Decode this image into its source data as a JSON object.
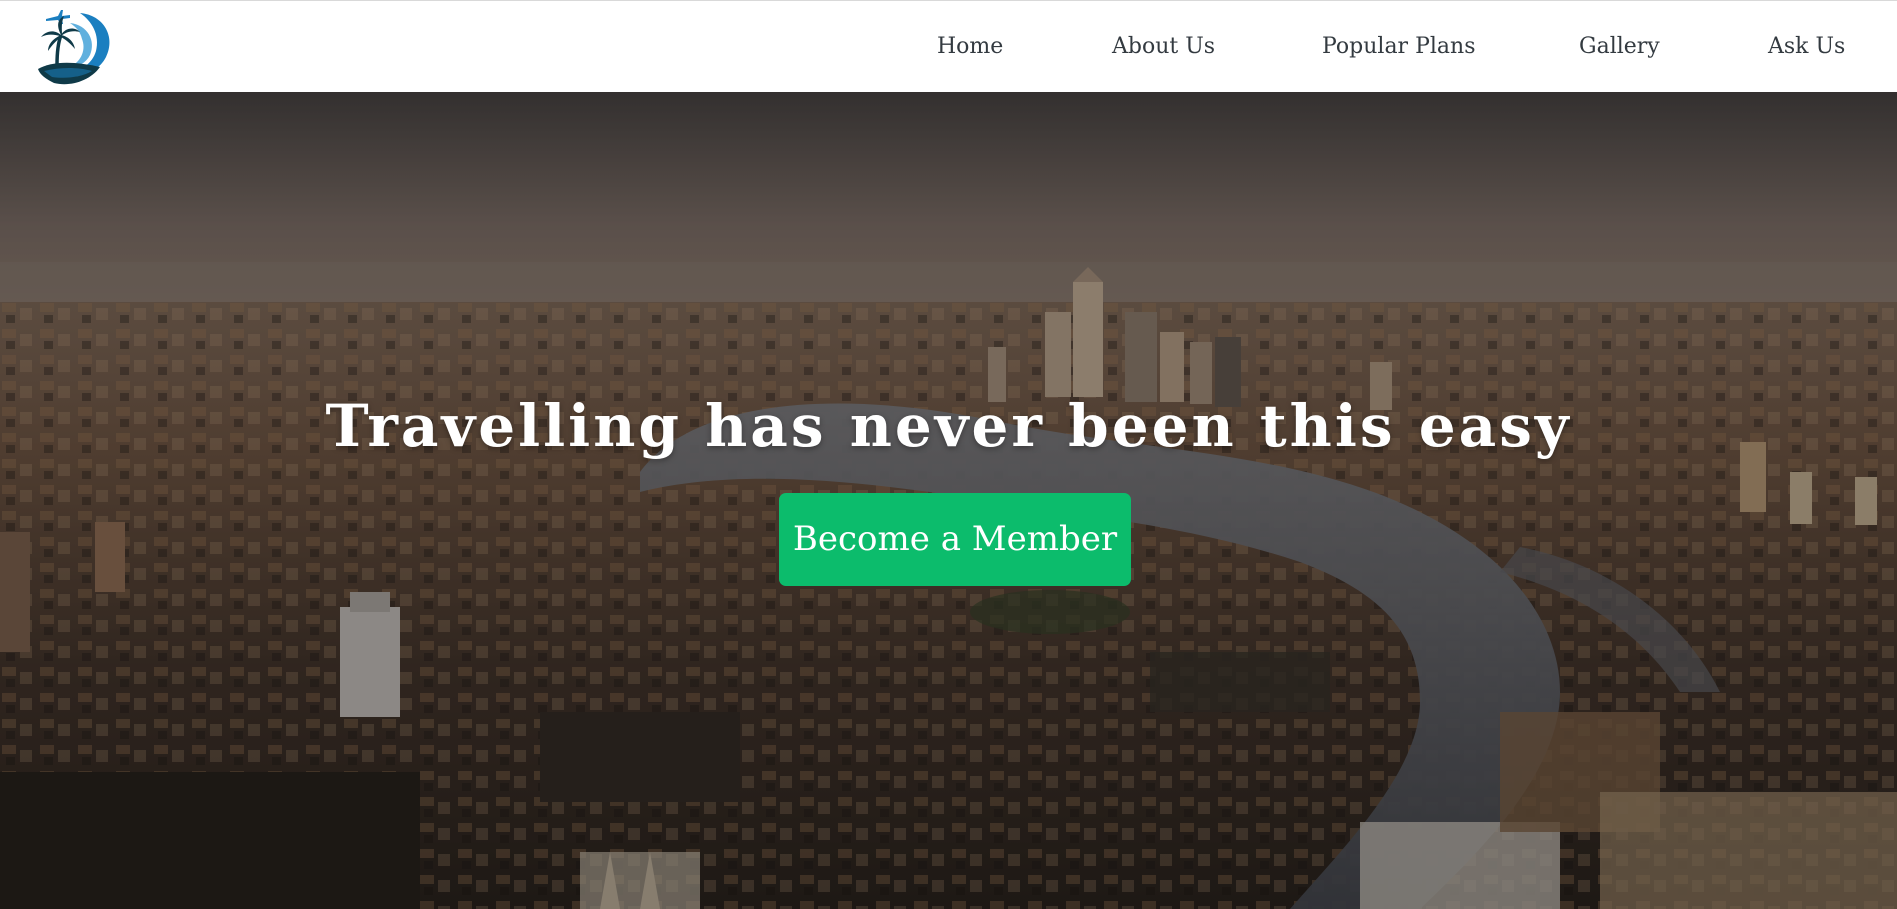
{
  "brand": {
    "logo_icon": "palm-moon-airplane-logo",
    "colors": {
      "logo_blue": "#1b7fc0",
      "logo_dark": "#0f3a48"
    }
  },
  "nav": {
    "items": [
      {
        "label": "Home"
      },
      {
        "label": "About Us"
      },
      {
        "label": "Popular Plans"
      },
      {
        "label": "Gallery"
      },
      {
        "label": "Ask Us"
      }
    ]
  },
  "hero": {
    "heading": "Travelling has never been this easy",
    "cta_label": "Become a Member",
    "background": "aerial city skyline with river at dusk",
    "colors": {
      "cta": "#0cbc6c",
      "heading": "#ffffff"
    }
  }
}
